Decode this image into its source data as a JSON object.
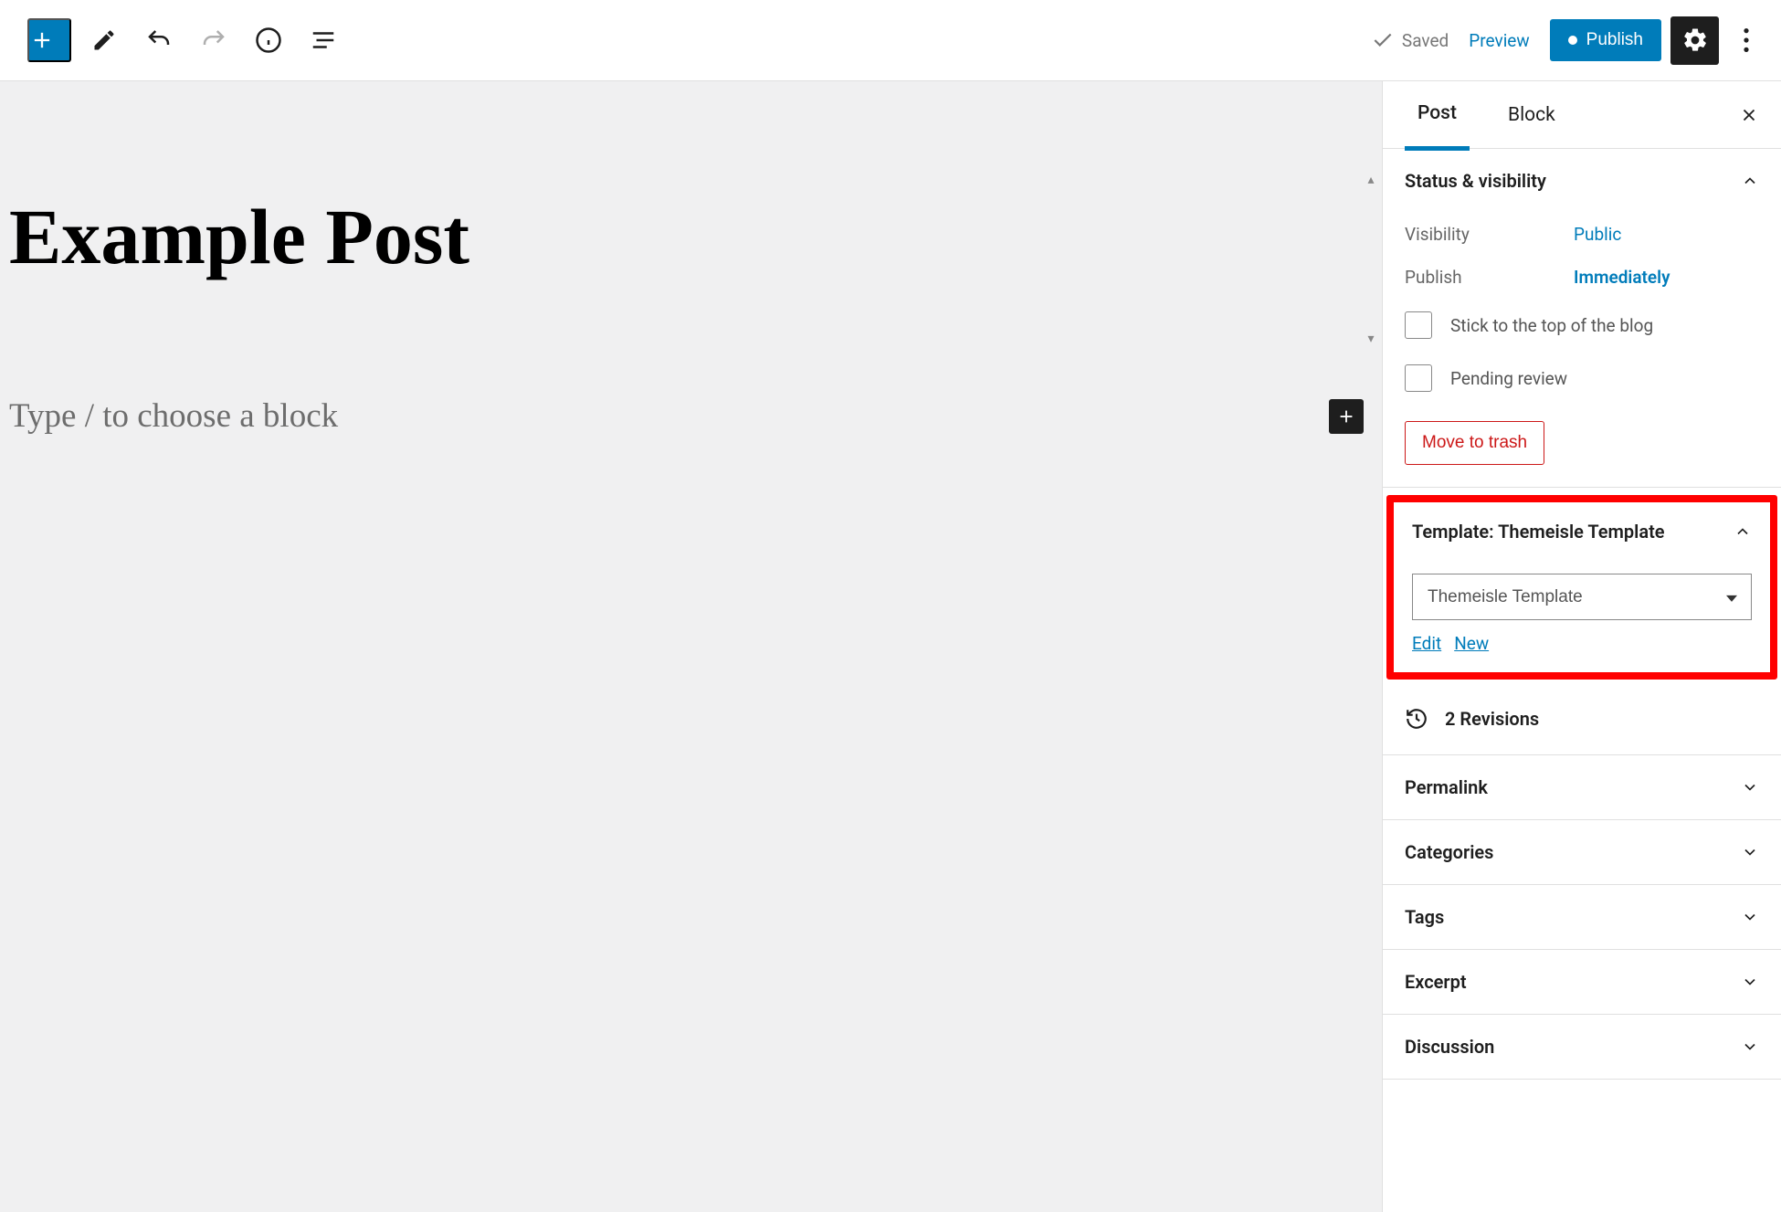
{
  "topbar": {
    "saved": "Saved",
    "preview": "Preview",
    "publish": "Publish"
  },
  "editor": {
    "title": "Example Post",
    "placeholder": "Type / to choose a block"
  },
  "sidebar": {
    "tabs": {
      "post": "Post",
      "block": "Block"
    },
    "status": {
      "title": "Status & visibility",
      "visibility_label": "Visibility",
      "visibility_value": "Public",
      "publish_label": "Publish",
      "publish_value": "Immediately",
      "stick": "Stick to the top of the blog",
      "pending": "Pending review",
      "trash": "Move to trash"
    },
    "template": {
      "title": "Template: Themeisle Template",
      "selected": "Themeisle Template",
      "edit": "Edit",
      "new": "New"
    },
    "revisions": "2 Revisions",
    "permalink": "Permalink",
    "categories": "Categories",
    "tags": "Tags",
    "excerpt": "Excerpt",
    "discussion": "Discussion"
  }
}
